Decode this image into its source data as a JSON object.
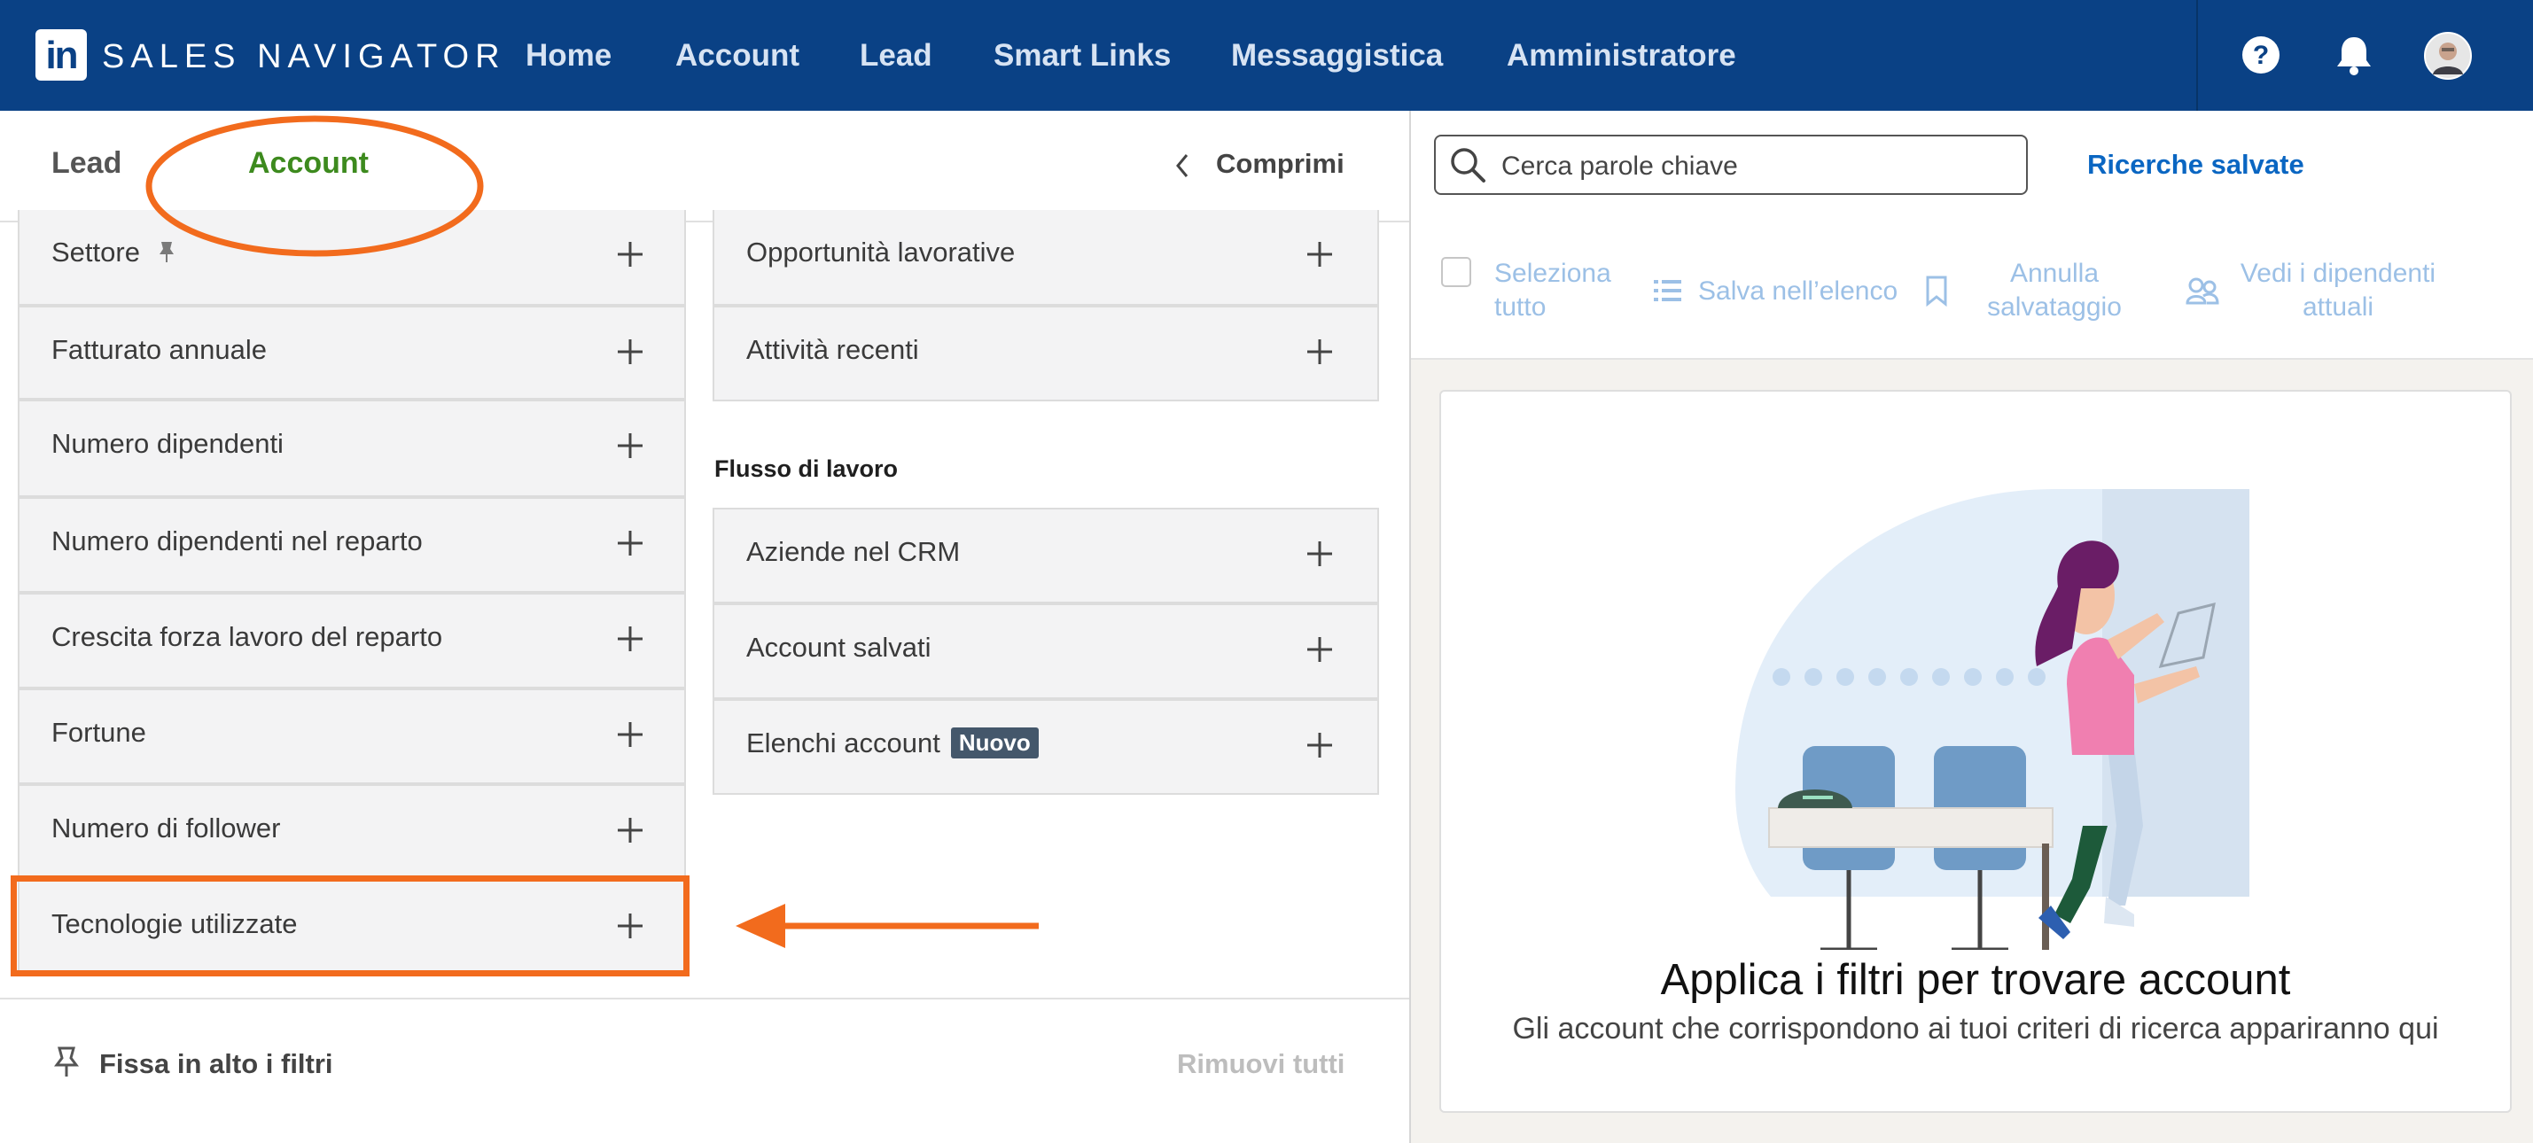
{
  "nav": {
    "brand": "SALES NAVIGATOR",
    "links": [
      "Home",
      "Account",
      "Lead",
      "Smart Links",
      "Messaggistica",
      "Amministratore"
    ],
    "logo": "in"
  },
  "filters": {
    "tabs": {
      "lead": "Lead",
      "account": "Account"
    },
    "collapse_label": "Comprimi",
    "left_column": [
      "Settore",
      "Fatturato annuale",
      "Numero dipendenti",
      "Numero dipendenti nel reparto",
      "Crescita forza lavoro del reparto",
      "Fortune",
      "Numero di follower",
      "Tecnologie utilizzate"
    ],
    "right_column": [
      "Opportunità lavorative",
      "Attività recenti"
    ],
    "workflow_title": "Flusso di lavoro",
    "workflow": [
      "Aziende nel CRM",
      "Account salvati",
      "Elenchi account"
    ],
    "new_badge": "Nuovo",
    "pin_label": "Fissa in alto i filtri",
    "remove_all": "Rimuovi tutti"
  },
  "search": {
    "placeholder": "Cerca parole chiave",
    "saved_searches": "Ricerche salvate"
  },
  "actions": {
    "select_all": "Seleziona tutto",
    "save_to_list": "Salva nell’elenco",
    "unsave": "Annulla salvataggio",
    "view_employees": "Vedi i dipendenti attuali"
  },
  "empty_state": {
    "title": "Applica i filtri per trovare account",
    "subtitle": "Gli account che corrispondono ai tuoi criteri di ricerca appariranno qui"
  },
  "colors": {
    "nav_bg": "#0a4185",
    "active_tab": "#3d8a1e",
    "link_blue": "#0a66c2",
    "annotation_orange": "#f26b1d"
  },
  "icons": [
    "help-icon",
    "bell-icon",
    "avatar",
    "pin-icon",
    "plus-icon",
    "search-icon",
    "chevron-left-icon",
    "list-icon",
    "bookmark-icon",
    "people-icon"
  ]
}
